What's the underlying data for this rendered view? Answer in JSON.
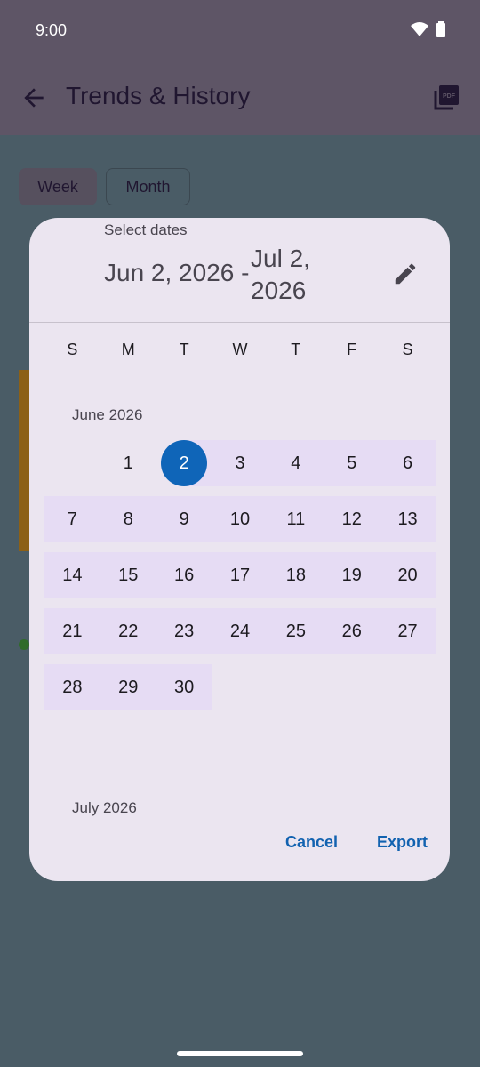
{
  "status_bar": {
    "time": "9:00"
  },
  "app_bar": {
    "title": "Trends & History",
    "pdf_icon_label": "PDF"
  },
  "segments": {
    "week": "Week",
    "month": "Month"
  },
  "dialog": {
    "headline": "Select dates",
    "range_start": "Jun 2, 2026 -",
    "range_end": "Jul 2, 2026",
    "weekdays": [
      "S",
      "M",
      "T",
      "W",
      "T",
      "F",
      "S"
    ],
    "months": [
      {
        "label": "June 2026",
        "weeks": [
          [
            "",
            "1",
            "2",
            "3",
            "4",
            "5",
            "6"
          ],
          [
            "7",
            "8",
            "9",
            "10",
            "11",
            "12",
            "13"
          ],
          [
            "14",
            "15",
            "16",
            "17",
            "18",
            "19",
            "20"
          ],
          [
            "21",
            "22",
            "23",
            "24",
            "25",
            "26",
            "27"
          ],
          [
            "28",
            "29",
            "30",
            "",
            "",
            "",
            ""
          ]
        ],
        "selected_start": "2"
      },
      {
        "label": "July 2026"
      }
    ],
    "cancel_label": "Cancel",
    "export_label": "Export"
  },
  "colors": {
    "accent": "#0f65b8",
    "range_fill": "#e6dcf4",
    "dialog_bg": "#ebe5f0"
  }
}
